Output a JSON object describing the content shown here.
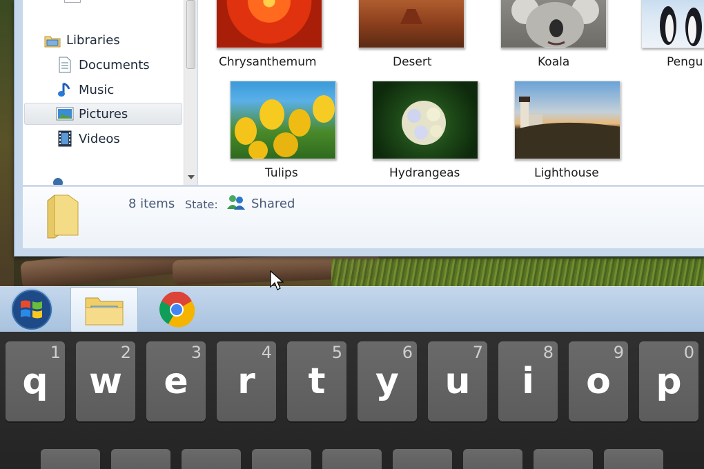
{
  "nav_pane": {
    "items": [
      {
        "label": "Libraries",
        "icon": "libraries-icon"
      },
      {
        "label": "Documents",
        "icon": "documents-icon"
      },
      {
        "label": "Music",
        "icon": "music-icon"
      },
      {
        "label": "Pictures",
        "icon": "pictures-icon",
        "selected": true
      },
      {
        "label": "Videos",
        "icon": "videos-icon"
      }
    ]
  },
  "content": {
    "thumbnails": [
      {
        "label": "Chrysanthemum"
      },
      {
        "label": "Desert"
      },
      {
        "label": "Koala"
      },
      {
        "label": "Pengu"
      },
      {
        "label": "Tulips"
      },
      {
        "label": "Hydrangeas"
      },
      {
        "label": "Lighthouse"
      }
    ]
  },
  "details": {
    "count": "8 items",
    "state_label": "State:",
    "state_value": "Shared"
  },
  "taskbar": {
    "buttons": [
      {
        "icon": "windows-start-icon"
      },
      {
        "icon": "folder-explorer-icon",
        "active": true
      },
      {
        "icon": "chrome-icon"
      }
    ]
  },
  "keyboard": {
    "row1": [
      {
        "letter": "q",
        "num": "1"
      },
      {
        "letter": "w",
        "num": "2"
      },
      {
        "letter": "e",
        "num": "3"
      },
      {
        "letter": "r",
        "num": "4"
      },
      {
        "letter": "t",
        "num": "5"
      },
      {
        "letter": "y",
        "num": "6"
      },
      {
        "letter": "u",
        "num": "7"
      },
      {
        "letter": "i",
        "num": "8"
      },
      {
        "letter": "o",
        "num": "9"
      },
      {
        "letter": "p",
        "num": "0"
      }
    ]
  },
  "colors": {
    "taskbar": "#b8cde6",
    "keyboard_bg": "#2a2a2a",
    "key": "#626262",
    "window_frame": "#c8d8ec"
  }
}
